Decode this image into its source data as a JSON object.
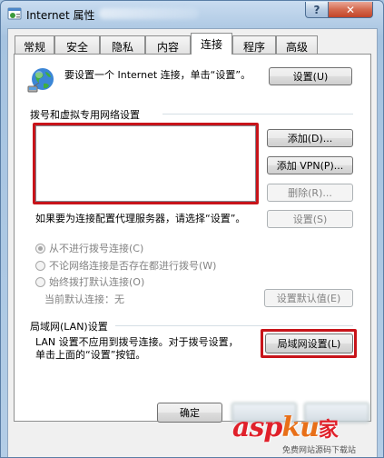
{
  "window": {
    "title": "Internet 属性",
    "help_label": "?",
    "close_label": "✕"
  },
  "tabs": [
    {
      "label": "常规"
    },
    {
      "label": "安全"
    },
    {
      "label": "隐私"
    },
    {
      "label": "内容"
    },
    {
      "label": "连接",
      "active": true
    },
    {
      "label": "程序"
    },
    {
      "label": "高级"
    }
  ],
  "setup": {
    "text": "要设置一个 Internet 连接，单击“设置”。",
    "button": "设置(U)"
  },
  "dialup": {
    "section_label": "拨号和虚拟专用网络设置",
    "add_button": "添加(D)...",
    "add_vpn_button": "添加 VPN(P)...",
    "remove_button": "删除(R)...",
    "proxy_text": "如果要为连接配置代理服务器，请选择“设置”。",
    "settings_button": "设置(S)",
    "radio_options": [
      {
        "label": "从不进行拨号连接(C)",
        "checked": true
      },
      {
        "label": "不论网络连接是否存在都进行拨号(W)",
        "checked": false
      },
      {
        "label": "始终拨打默认连接(O)",
        "checked": false
      }
    ],
    "current_default": "当前默认连接：无",
    "set_default_button": "设置默认值(E)"
  },
  "lan": {
    "section_label": "局域网(LAN)设置",
    "text": "LAN 设置不应用到拨号连接。对于拨号设置，单击上面的“设置”按钮。",
    "button": "局域网设置(L)"
  },
  "footer": {
    "ok_button": "确定"
  },
  "watermark": {
    "brand_a": "asp",
    "brand_b": "ku",
    "brand_c": "家",
    "sub": "免费网站源码下载站"
  },
  "colors": {
    "highlight_border": "#c8141a",
    "disabled_text": "#838383"
  }
}
